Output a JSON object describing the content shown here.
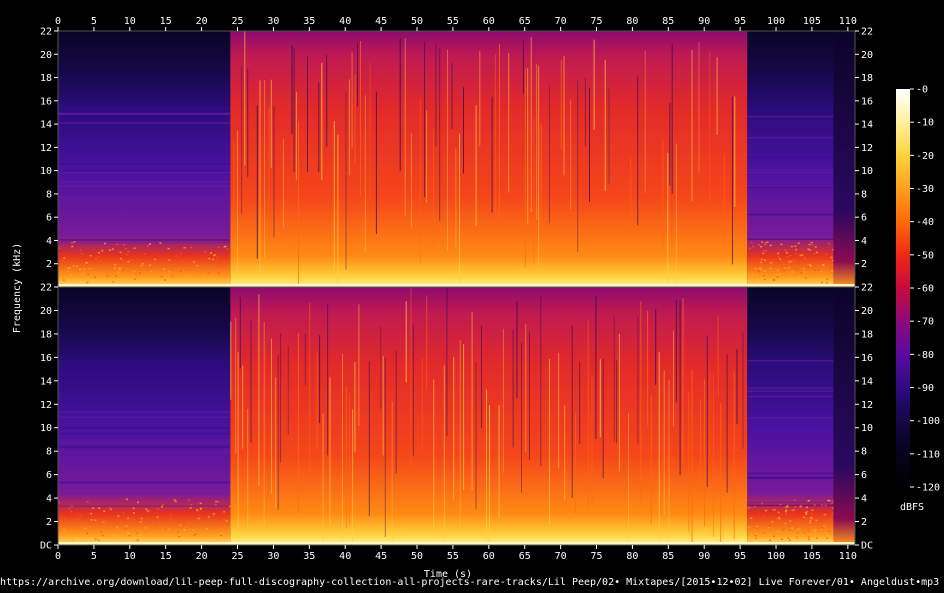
{
  "chart_data": {
    "type": "heatmap",
    "title": "",
    "xlabel": "Time (s)",
    "ylabel": "Frequency (kHz)",
    "x_range": [
      0,
      111
    ],
    "x_ticks": [
      "0",
      "5",
      "10",
      "15",
      "20",
      "25",
      "30",
      "35",
      "40",
      "45",
      "50",
      "55",
      "60",
      "65",
      "70",
      "75",
      "80",
      "85",
      "90",
      "95",
      "100",
      "105",
      "110"
    ],
    "channels": [
      {
        "y_range": [
          0,
          22
        ],
        "y_ticks": [
          "22",
          "20",
          "18",
          "16",
          "14",
          "12",
          "10",
          "8",
          "6",
          "4",
          "2"
        ]
      },
      {
        "y_range": [
          0,
          22
        ],
        "y_ticks": [
          "22",
          "20",
          "18",
          "16",
          "14",
          "12",
          "10",
          "8",
          "6",
          "4",
          "2",
          "DC"
        ]
      }
    ],
    "colorbar": {
      "label": "dBFS",
      "range": [
        -120,
        0
      ],
      "ticks": [
        "-0",
        "-10",
        "-20",
        "-30",
        "-40",
        "-50",
        "-60",
        "-70",
        "-80",
        "-90",
        "-100",
        "-110",
        "-120"
      ],
      "stops": [
        "#ffffff",
        "#fff1a0",
        "#ffd23c",
        "#ffa01e",
        "#ff6a0a",
        "#f02814",
        "#c80a3c",
        "#8c0a78",
        "#5a0aa0",
        "#2d0a82",
        "#140846",
        "#05021a",
        "#000000"
      ]
    },
    "segments": [
      {
        "t_start": 0,
        "t_end": 24,
        "level": "quiet",
        "note": "intro: energy mostly below ~4 kHz"
      },
      {
        "t_start": 24,
        "t_end": 96,
        "level": "loud",
        "note": "full band energy up to 22 kHz"
      },
      {
        "t_start": 96,
        "t_end": 108,
        "level": "quiet",
        "note": "outro: energy below ~4 kHz"
      },
      {
        "t_start": 108,
        "t_end": 111,
        "level": "silent",
        "note": "end"
      }
    ]
  },
  "source_path": "https://archive.org/download/lil-peep-full-discography-collection-all-projects-rare-tracks/Lil Peep/02• Mixtapes/[2015•12•02] Live Forever/01• Angeldust•mp3"
}
